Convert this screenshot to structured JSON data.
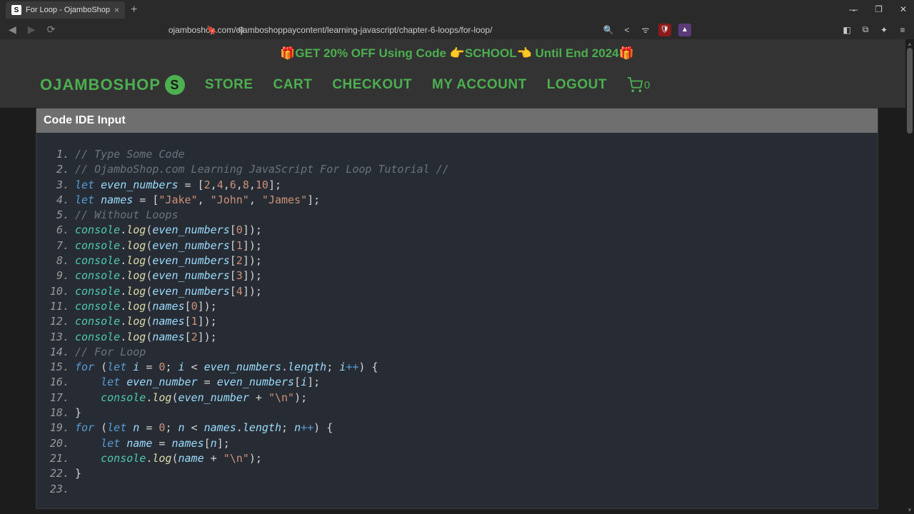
{
  "browser": {
    "tab_title": "For Loop - OjamboShop",
    "url": "ojamboshop.com/ojamboshoppaycontent/learning-javascript/chapter-6-loops/for-loop/"
  },
  "banner": {
    "text": "🎁GET 20% OFF Using Code 👉SCHOOL👈 Until End 2024🎁"
  },
  "nav": {
    "brand": "OJAMBOSHOP",
    "links": {
      "store": "STORE",
      "cart": "CART",
      "checkout": "CHECKOUT",
      "account": "MY ACCOUNT",
      "logout": "LOGOUT"
    },
    "cart_count": "0"
  },
  "ide": {
    "header": "Code IDE Input",
    "code": {
      "l1_comment": "// Type Some Code",
      "l2_comment": "// OjamboShop.com Learning JavaScript For Loop Tutorial //",
      "l3": {
        "let": "let",
        "var": "even_numbers",
        "eq": " = ",
        "open": "[",
        "v1": "2",
        "c": ",",
        "v2": "4",
        "v3": "6",
        "v4": "8",
        "v5": "10",
        "close": "];"
      },
      "l4": {
        "let": "let",
        "var": "names",
        "eq": " = ",
        "open": "[",
        "s1": "\"Jake\"",
        "c": ", ",
        "s2": "\"John\"",
        "s3": "\"James\"",
        "close": "];"
      },
      "l5_comment": "// Without Loops",
      "logs_even": [
        {
          "obj": "console",
          "dot": ".",
          "method": "log",
          "open": "(",
          "var": "even_numbers",
          "bopen": "[",
          "idx": "0",
          "bclose": "]",
          "close": ");"
        },
        {
          "obj": "console",
          "dot": ".",
          "method": "log",
          "open": "(",
          "var": "even_numbers",
          "bopen": "[",
          "idx": "1",
          "bclose": "]",
          "close": ");"
        },
        {
          "obj": "console",
          "dot": ".",
          "method": "log",
          "open": "(",
          "var": "even_numbers",
          "bopen": "[",
          "idx": "2",
          "bclose": "]",
          "close": ");"
        },
        {
          "obj": "console",
          "dot": ".",
          "method": "log",
          "open": "(",
          "var": "even_numbers",
          "bopen": "[",
          "idx": "3",
          "bclose": "]",
          "close": ");"
        },
        {
          "obj": "console",
          "dot": ".",
          "method": "log",
          "open": "(",
          "var": "even_numbers",
          "bopen": "[",
          "idx": "4",
          "bclose": "]",
          "close": ");"
        }
      ],
      "logs_names": [
        {
          "obj": "console",
          "dot": ".",
          "method": "log",
          "open": "(",
          "var": "names",
          "bopen": "[",
          "idx": "0",
          "bclose": "]",
          "close": ");"
        },
        {
          "obj": "console",
          "dot": ".",
          "method": "log",
          "open": "(",
          "var": "names",
          "bopen": "[",
          "idx": "1",
          "bclose": "]",
          "close": ");"
        },
        {
          "obj": "console",
          "dot": ".",
          "method": "log",
          "open": "(",
          "var": "names",
          "bopen": "[",
          "idx": "2",
          "bclose": "]",
          "close": ");"
        }
      ],
      "l14_comment": "// For Loop",
      "l15": {
        "for": "for",
        "po": " (",
        "let": "let",
        "v": "i",
        "eq": " = ",
        "z": "0",
        "sc": "; ",
        "v2": "i",
        "lt": " < ",
        "arr": "even_numbers",
        "dot": ".",
        "prop": "length",
        "sc2": "; ",
        "v3": "i",
        "inc": "++",
        "pc": ") ",
        "brace": "{"
      },
      "l16": {
        "indent": "    ",
        "let": "let",
        "v": "even_number",
        "eq": " = ",
        "arr": "even_numbers",
        "bo": "[",
        "idx": "i",
        "bc": "];"
      },
      "l17": {
        "indent": "    ",
        "obj": "console",
        "dot": ".",
        "method": "log",
        "po": "(",
        "v": "even_number",
        "plus": " + ",
        "str": "\"\\n\"",
        "pc": ");"
      },
      "l18": {
        "brace": "}"
      },
      "l19": {
        "for": "for",
        "po": " (",
        "let": "let",
        "v": "n",
        "eq": " = ",
        "z": "0",
        "sc": "; ",
        "v2": "n",
        "lt": " < ",
        "arr": "names",
        "dot": ".",
        "prop": "length",
        "sc2": "; ",
        "v3": "n",
        "inc": "++",
        "pc": ") ",
        "brace": "{"
      },
      "l20": {
        "indent": "    ",
        "let": "let",
        "v": "name",
        "eq": " = ",
        "arr": "names",
        "bo": "[",
        "idx": "n",
        "bc": "];"
      },
      "l21": {
        "indent": "    ",
        "obj": "console",
        "dot": ".",
        "method": "log",
        "po": "(",
        "v": "name",
        "plus": " + ",
        "str": "\"\\n\"",
        "pc": ");"
      },
      "l22": {
        "brace": "}"
      }
    }
  }
}
